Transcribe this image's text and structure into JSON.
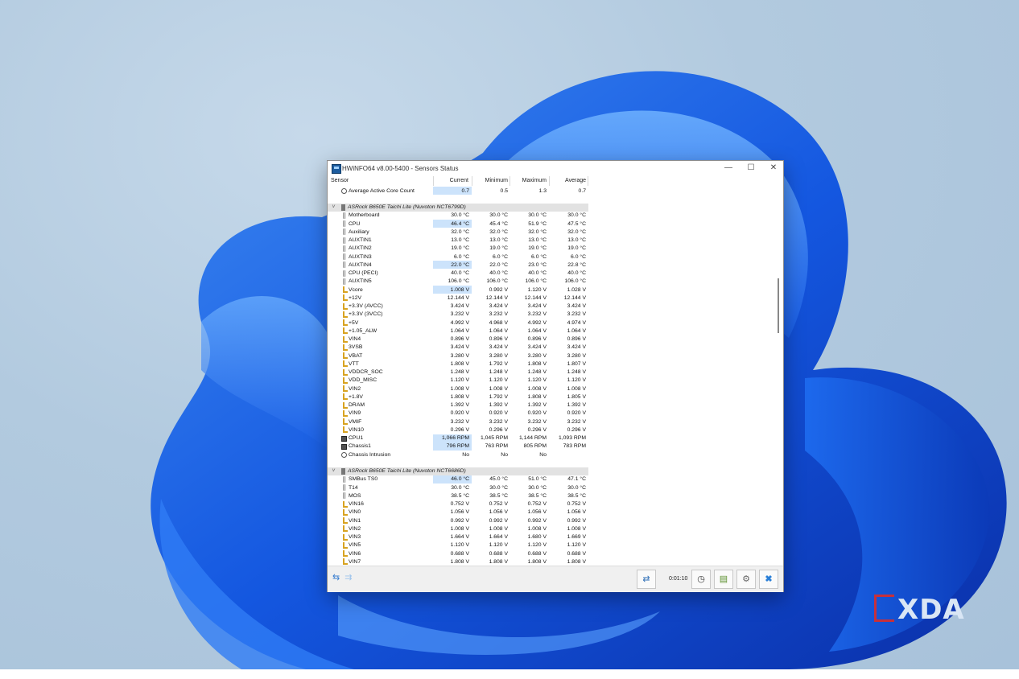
{
  "window": {
    "title": "HWiNFO64 v8.00-5400 - Sensors Status",
    "controls": {
      "minimize": "—",
      "maximize": "☐",
      "close": "✕"
    }
  },
  "header": {
    "sensor": "Sensor",
    "current": "Current",
    "minimum": "Minimum",
    "maximum": "Maximum",
    "average": "Average"
  },
  "rows": [
    {
      "kind": "sensor",
      "icon": "clock",
      "name": "Average Active Core Count",
      "cur": "0.7",
      "min": "0.5",
      "max": "1.3",
      "avg": "0.7",
      "hl": true
    },
    {
      "kind": "blank"
    },
    {
      "kind": "group",
      "name": "ASRock B650E Taichi Lite (Nuvoton NCT6799D)"
    },
    {
      "kind": "sensor",
      "icon": "temp",
      "name": "Motherboard",
      "cur": "30.0 °C",
      "min": "30.0 °C",
      "max": "30.0 °C",
      "avg": "30.0 °C"
    },
    {
      "kind": "sensor",
      "icon": "temp",
      "name": "CPU",
      "cur": "46.4 °C",
      "min": "45.4 °C",
      "max": "51.9 °C",
      "avg": "47.5 °C",
      "hl": true
    },
    {
      "kind": "sensor",
      "icon": "temp",
      "name": "Auxiliary",
      "cur": "32.0 °C",
      "min": "32.0 °C",
      "max": "32.0 °C",
      "avg": "32.0 °C"
    },
    {
      "kind": "sensor",
      "icon": "temp",
      "name": "AUXTIN1",
      "cur": "13.0 °C",
      "min": "13.0 °C",
      "max": "13.0 °C",
      "avg": "13.0 °C"
    },
    {
      "kind": "sensor",
      "icon": "temp",
      "name": "AUXTIN2",
      "cur": "19.0 °C",
      "min": "19.0 °C",
      "max": "19.0 °C",
      "avg": "19.0 °C"
    },
    {
      "kind": "sensor",
      "icon": "temp",
      "name": "AUXTIN3",
      "cur": "6.0 °C",
      "min": "6.0 °C",
      "max": "6.0 °C",
      "avg": "6.0 °C"
    },
    {
      "kind": "sensor",
      "icon": "temp",
      "name": "AUXTIN4",
      "cur": "22.0 °C",
      "min": "22.0 °C",
      "max": "23.0 °C",
      "avg": "22.8 °C",
      "hl": true
    },
    {
      "kind": "sensor",
      "icon": "temp",
      "name": "CPU (PECI)",
      "cur": "40.0 °C",
      "min": "40.0 °C",
      "max": "40.0 °C",
      "avg": "40.0 °C"
    },
    {
      "kind": "sensor",
      "icon": "temp",
      "name": "AUXTIN5",
      "cur": "106.0 °C",
      "min": "106.0 °C",
      "max": "106.0 °C",
      "avg": "106.0 °C"
    },
    {
      "kind": "sensor",
      "icon": "volt",
      "name": "Vcore",
      "cur": "1.008 V",
      "min": "0.992 V",
      "max": "1.120 V",
      "avg": "1.028 V",
      "hl": true
    },
    {
      "kind": "sensor",
      "icon": "volt",
      "name": "+12V",
      "cur": "12.144 V",
      "min": "12.144 V",
      "max": "12.144 V",
      "avg": "12.144 V"
    },
    {
      "kind": "sensor",
      "icon": "volt",
      "name": "+3.3V (AVCC)",
      "cur": "3.424 V",
      "min": "3.424 V",
      "max": "3.424 V",
      "avg": "3.424 V"
    },
    {
      "kind": "sensor",
      "icon": "volt",
      "name": "+3.3V (3VCC)",
      "cur": "3.232 V",
      "min": "3.232 V",
      "max": "3.232 V",
      "avg": "3.232 V"
    },
    {
      "kind": "sensor",
      "icon": "volt",
      "name": "+5V",
      "cur": "4.992 V",
      "min": "4.968 V",
      "max": "4.992 V",
      "avg": "4.974 V"
    },
    {
      "kind": "sensor",
      "icon": "volt",
      "name": "+1.05_ALW",
      "cur": "1.064 V",
      "min": "1.064 V",
      "max": "1.064 V",
      "avg": "1.064 V"
    },
    {
      "kind": "sensor",
      "icon": "volt",
      "name": "VIN4",
      "cur": "0.896 V",
      "min": "0.896 V",
      "max": "0.896 V",
      "avg": "0.896 V"
    },
    {
      "kind": "sensor",
      "icon": "volt",
      "name": "3VSB",
      "cur": "3.424 V",
      "min": "3.424 V",
      "max": "3.424 V",
      "avg": "3.424 V"
    },
    {
      "kind": "sensor",
      "icon": "volt",
      "name": "VBAT",
      "cur": "3.280 V",
      "min": "3.280 V",
      "max": "3.280 V",
      "avg": "3.280 V"
    },
    {
      "kind": "sensor",
      "icon": "volt",
      "name": "VTT",
      "cur": "1.808 V",
      "min": "1.792 V",
      "max": "1.808 V",
      "avg": "1.807 V"
    },
    {
      "kind": "sensor",
      "icon": "volt",
      "name": "VDDCR_SOC",
      "cur": "1.248 V",
      "min": "1.248 V",
      "max": "1.248 V",
      "avg": "1.248 V"
    },
    {
      "kind": "sensor",
      "icon": "volt",
      "name": "VDD_MISC",
      "cur": "1.120 V",
      "min": "1.120 V",
      "max": "1.120 V",
      "avg": "1.120 V"
    },
    {
      "kind": "sensor",
      "icon": "volt",
      "name": "VIN2",
      "cur": "1.008 V",
      "min": "1.008 V",
      "max": "1.008 V",
      "avg": "1.008 V"
    },
    {
      "kind": "sensor",
      "icon": "volt",
      "name": "+1.8V",
      "cur": "1.808 V",
      "min": "1.792 V",
      "max": "1.808 V",
      "avg": "1.805 V"
    },
    {
      "kind": "sensor",
      "icon": "volt",
      "name": "DRAM",
      "cur": "1.392 V",
      "min": "1.392 V",
      "max": "1.392 V",
      "avg": "1.392 V"
    },
    {
      "kind": "sensor",
      "icon": "volt",
      "name": "VIN9",
      "cur": "0.920 V",
      "min": "0.920 V",
      "max": "0.920 V",
      "avg": "0.920 V"
    },
    {
      "kind": "sensor",
      "icon": "volt",
      "name": "VMIF",
      "cur": "3.232 V",
      "min": "3.232 V",
      "max": "3.232 V",
      "avg": "3.232 V"
    },
    {
      "kind": "sensor",
      "icon": "volt",
      "name": "VIN10",
      "cur": "0.296 V",
      "min": "0.296 V",
      "max": "0.296 V",
      "avg": "0.296 V"
    },
    {
      "kind": "sensor",
      "icon": "fan",
      "name": "CPU1",
      "cur": "1,066 RPM",
      "min": "1,045 RPM",
      "max": "1,144 RPM",
      "avg": "1,093 RPM",
      "hl": true
    },
    {
      "kind": "sensor",
      "icon": "fan",
      "name": "Chassis1",
      "cur": "796 RPM",
      "min": "763 RPM",
      "max": "805 RPM",
      "avg": "783 RPM",
      "hl": true
    },
    {
      "kind": "sensor",
      "icon": "clock",
      "name": "Chassis Intrusion",
      "cur": "No",
      "min": "No",
      "max": "No",
      "avg": ""
    },
    {
      "kind": "blank"
    },
    {
      "kind": "group",
      "name": "ASRock B650E Taichi Lite (Nuvoton NCT6686D)"
    },
    {
      "kind": "sensor",
      "icon": "temp",
      "name": "SMBus TS0",
      "cur": "46.0 °C",
      "min": "45.0 °C",
      "max": "51.0 °C",
      "avg": "47.1 °C",
      "hl": true
    },
    {
      "kind": "sensor",
      "icon": "temp",
      "name": "T14",
      "cur": "30.0 °C",
      "min": "30.0 °C",
      "max": "30.0 °C",
      "avg": "30.0 °C"
    },
    {
      "kind": "sensor",
      "icon": "temp",
      "name": "MOS",
      "cur": "38.5 °C",
      "min": "38.5 °C",
      "max": "38.5 °C",
      "avg": "38.5 °C"
    },
    {
      "kind": "sensor",
      "icon": "volt",
      "name": "VIN16",
      "cur": "0.752 V",
      "min": "0.752 V",
      "max": "0.752 V",
      "avg": "0.752 V"
    },
    {
      "kind": "sensor",
      "icon": "volt",
      "name": "VIN0",
      "cur": "1.056 V",
      "min": "1.056 V",
      "max": "1.056 V",
      "avg": "1.056 V"
    },
    {
      "kind": "sensor",
      "icon": "volt",
      "name": "VIN1",
      "cur": "0.992 V",
      "min": "0.992 V",
      "max": "0.992 V",
      "avg": "0.992 V"
    },
    {
      "kind": "sensor",
      "icon": "volt",
      "name": "VIN2",
      "cur": "1.008 V",
      "min": "1.008 V",
      "max": "1.008 V",
      "avg": "1.008 V"
    },
    {
      "kind": "sensor",
      "icon": "volt",
      "name": "VIN3",
      "cur": "1.664 V",
      "min": "1.664 V",
      "max": "1.680 V",
      "avg": "1.669 V"
    },
    {
      "kind": "sensor",
      "icon": "volt",
      "name": "VIN5",
      "cur": "1.120 V",
      "min": "1.120 V",
      "max": "1.120 V",
      "avg": "1.120 V"
    },
    {
      "kind": "sensor",
      "icon": "volt",
      "name": "VIN6",
      "cur": "0.688 V",
      "min": "0.688 V",
      "max": "0.688 V",
      "avg": "0.688 V"
    },
    {
      "kind": "sensor",
      "icon": "volt",
      "name": "VIN7",
      "cur": "1.808 V",
      "min": "1.808 V",
      "max": "1.808 V",
      "avg": "1.808 V"
    }
  ],
  "toolbar": {
    "nav_left_icon": "arrows-left-right-icon",
    "nav_right_icon": "arrows-right-icon",
    "network_icon": "network-icon",
    "timer": "0:01:10",
    "clock_icon": "clock-icon",
    "report_icon": "report-icon",
    "settings_icon": "gear-icon",
    "close_icon": "close-icon"
  },
  "watermark": "XDA",
  "colors": {
    "highlight": "#cce3fb",
    "group_bar": "#e2e2e2",
    "accent": "#2f6fb7"
  }
}
